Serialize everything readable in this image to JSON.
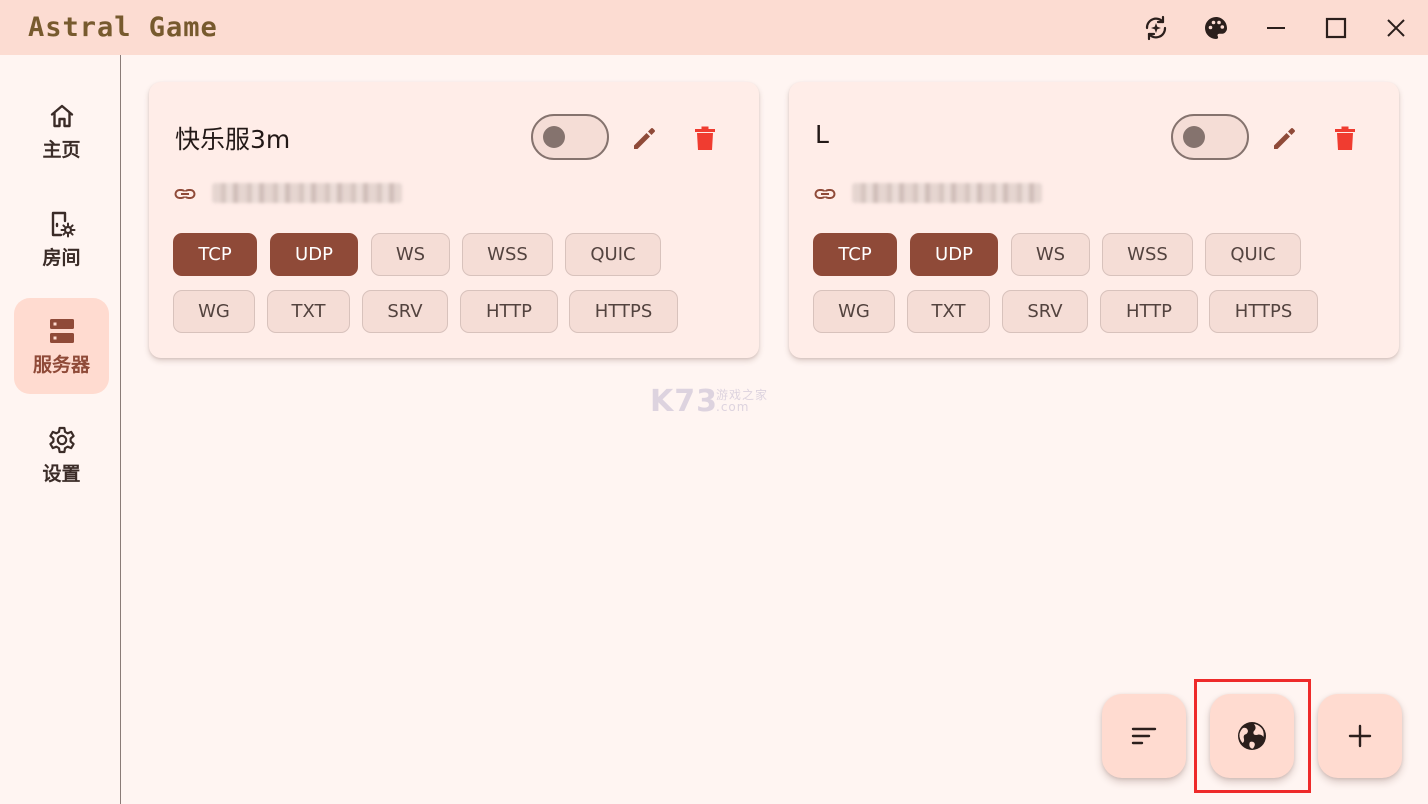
{
  "app": {
    "title": "Astral Game",
    "accent_color": "#8f4a38",
    "titlebar_color": "#fcdcd2",
    "title_color": "#775a2e"
  },
  "titlebar": {
    "icons": [
      "sync-sparkle-icon",
      "palette-icon",
      "minimize-icon",
      "maximize-icon",
      "close-icon"
    ]
  },
  "sidebar": {
    "items": [
      {
        "label": "主页",
        "icon": "home-icon",
        "active": false
      },
      {
        "label": "房间",
        "icon": "room-settings-icon",
        "active": false
      },
      {
        "label": "服务器",
        "icon": "server-icon",
        "active": true
      },
      {
        "label": "设置",
        "icon": "gear-icon",
        "active": false
      }
    ]
  },
  "servers": [
    {
      "name": "快乐服3m",
      "enabled": false,
      "protocols": [
        {
          "label": "TCP",
          "on": true
        },
        {
          "label": "UDP",
          "on": true
        },
        {
          "label": "WS",
          "on": false
        },
        {
          "label": "WSS",
          "on": false
        },
        {
          "label": "QUIC",
          "on": false
        },
        {
          "label": "WG",
          "on": false
        },
        {
          "label": "TXT",
          "on": false
        },
        {
          "label": "SRV",
          "on": false
        },
        {
          "label": "HTTP",
          "on": false
        },
        {
          "label": "HTTPS",
          "on": false
        }
      ]
    },
    {
      "name": "L",
      "enabled": false,
      "protocols": [
        {
          "label": "TCP",
          "on": true
        },
        {
          "label": "UDP",
          "on": true
        },
        {
          "label": "WS",
          "on": false
        },
        {
          "label": "WSS",
          "on": false
        },
        {
          "label": "QUIC",
          "on": false
        },
        {
          "label": "WG",
          "on": false
        },
        {
          "label": "TXT",
          "on": false
        },
        {
          "label": "SRV",
          "on": false
        },
        {
          "label": "HTTP",
          "on": false
        },
        {
          "label": "HTTPS",
          "on": false
        }
      ]
    }
  ],
  "watermark": {
    "main": "K73",
    "sub": "游戏之家",
    "sub2": ".com"
  },
  "fabs": [
    "sort-icon",
    "globe-icon",
    "plus-icon"
  ]
}
